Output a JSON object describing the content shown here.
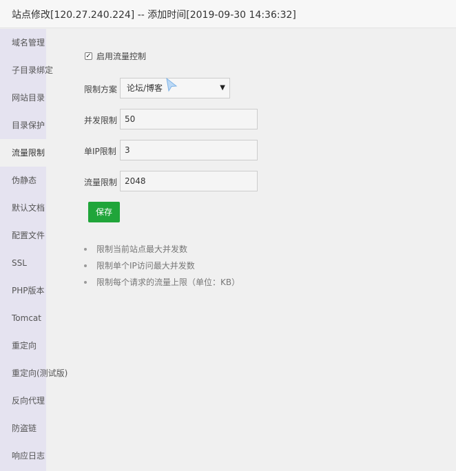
{
  "window": {
    "title": "站点修改[120.27.240.224] -- 添加时间[2019-09-30 14:36:32]"
  },
  "sidebar": {
    "items": [
      {
        "label": "域名管理"
      },
      {
        "label": "子目录绑定"
      },
      {
        "label": "网站目录"
      },
      {
        "label": "目录保护"
      },
      {
        "label": "流量限制"
      },
      {
        "label": "伪静态"
      },
      {
        "label": "默认文档"
      },
      {
        "label": "配置文件"
      },
      {
        "label": "SSL"
      },
      {
        "label": "PHP版本"
      },
      {
        "label": "Tomcat"
      },
      {
        "label": "重定向"
      },
      {
        "label": "重定向(测试版)"
      },
      {
        "label": "反向代理"
      },
      {
        "label": "防盗链"
      },
      {
        "label": "响应日志"
      }
    ],
    "active_item": "流量限制"
  },
  "form": {
    "enable_label": "启用流量控制",
    "enable_checked": true,
    "scheme_label": "限制方案",
    "scheme_value": "论坛/博客",
    "concurrency_label": "并发限制",
    "concurrency_value": "50",
    "per_ip_label": "单IP限制",
    "per_ip_value": "3",
    "rate_label": "流量限制",
    "rate_value": "2048",
    "save_label": "保存"
  },
  "tips": [
    "限制当前站点最大并发数",
    "限制单个IP访问最大并发数",
    "限制每个请求的流量上限（单位：KB）"
  ],
  "colors": {
    "accent": "#20a53a",
    "sidebar_bg": "#e5e3f0"
  },
  "icons": {
    "checkbox": "check-icon",
    "select_arrow": "triangle-down-icon",
    "cursor": "mouse-pointer-icon"
  }
}
